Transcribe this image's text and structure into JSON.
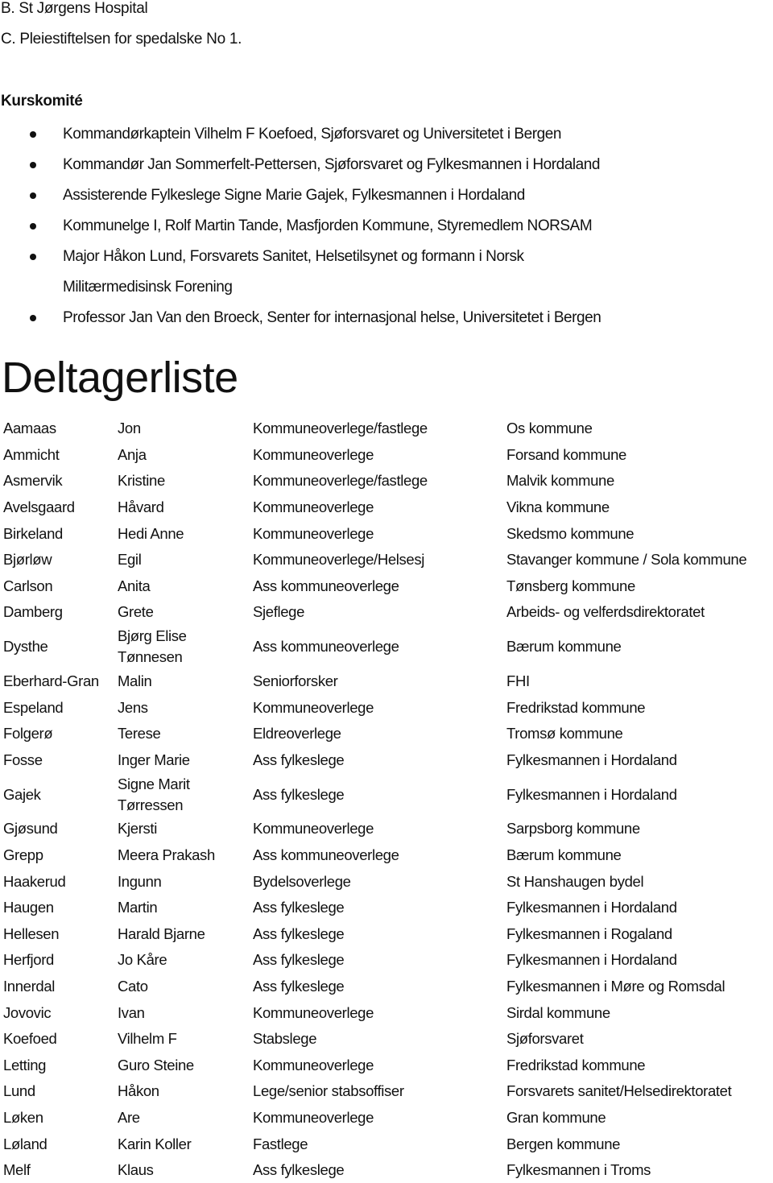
{
  "header_lines": [
    "B. St Jørgens Hospital",
    "C. Pleiestiftelsen for spedalske No 1."
  ],
  "committee": {
    "title": "Kurskomité",
    "items": [
      "Kommandørkaptein Vilhelm F Koefoed, Sjøforsvaret og Universitetet i Bergen",
      "Kommandør Jan Sommerfelt-Pettersen, Sjøforsvaret og Fylkesmannen i Hordaland",
      "Assisterende Fylkeslege Signe Marie Gajek, Fylkesmannen i Hordaland",
      "Kommunelge I, Rolf Martin Tande, Masfjorden Kommune, Styremedlem NORSAM",
      "Major Håkon Lund, Forsvarets Sanitet, Helsetilsynet og formann i Norsk",
      "Professor Jan Van den Broeck, Senter for internasjonal helse, Universitetet i Bergen"
    ],
    "item_continuation": "Militærmedisinsk Forening"
  },
  "participants": {
    "title": "Deltagerliste",
    "rows": [
      [
        "Aamaas",
        "Jon",
        "Kommuneoverlege/fastlege",
        "Os kommune"
      ],
      [
        "Ammicht",
        "Anja",
        "Kommuneoverlege",
        "Forsand kommune"
      ],
      [
        "Asmervik",
        "Kristine",
        "Kommuneoverlege/fastlege",
        "Malvik kommune"
      ],
      [
        "Avelsgaard",
        "Håvard",
        "Kommuneoverlege",
        "Vikna kommune"
      ],
      [
        "Birkeland",
        "Hedi Anne",
        "Kommuneoverlege",
        "Skedsmo kommune"
      ],
      [
        "Bjørløw",
        "Egil",
        "Kommuneoverlege/Helsesj",
        "Stavanger kommune / Sola kommune"
      ],
      [
        "Carlson",
        "Anita",
        "Ass kommuneoverlege",
        "Tønsberg kommune"
      ],
      [
        "Damberg",
        "Grete",
        "Sjeflege",
        "Arbeids- og velferdsdirektoratet"
      ],
      [
        "Dysthe",
        "Bjørg Elise Tønnesen",
        "Ass kommuneoverlege",
        "Bærum kommune"
      ],
      [
        "Eberhard-Gran",
        "Malin",
        "Seniorforsker",
        "FHI"
      ],
      [
        "Espeland",
        "Jens",
        "Kommuneoverlege",
        "Fredrikstad kommune"
      ],
      [
        "Folgerø",
        "Terese",
        "Eldreoverlege",
        "Tromsø kommune"
      ],
      [
        "Fosse",
        "Inger Marie",
        "Ass fylkeslege",
        "Fylkesmannen i Hordaland"
      ],
      [
        "Gajek",
        "Signe Marit Tørressen",
        "Ass fylkeslege",
        "Fylkesmannen i Hordaland"
      ],
      [
        "Gjøsund",
        "Kjersti",
        "Kommuneoverlege",
        "Sarpsborg kommune"
      ],
      [
        "Grepp",
        "Meera Prakash",
        "Ass kommuneoverlege",
        "Bærum kommune"
      ],
      [
        "Haakerud",
        "Ingunn",
        "Bydelsoverlege",
        "St Hanshaugen bydel"
      ],
      [
        "Haugen",
        "Martin",
        "Ass fylkeslege",
        "Fylkesmannen i Hordaland"
      ],
      [
        "Hellesen",
        "Harald Bjarne",
        "Ass fylkeslege",
        "Fylkesmannen i Rogaland"
      ],
      [
        "Herfjord",
        "Jo Kåre",
        "Ass fylkeslege",
        "Fylkesmannen i Hordaland"
      ],
      [
        "Innerdal",
        "Cato",
        "Ass fylkeslege",
        "Fylkesmannen i Møre og Romsdal"
      ],
      [
        "Jovovic",
        "Ivan",
        "Kommuneoverlege",
        "Sirdal kommune"
      ],
      [
        "Koefoed",
        "Vilhelm F",
        "Stabslege",
        "Sjøforsvaret"
      ],
      [
        "Letting",
        "Guro Steine",
        "Kommuneoverlege",
        "Fredrikstad kommune"
      ],
      [
        "Lund",
        "Håkon",
        "Lege/senior stabsoffiser",
        "Forsvarets sanitet/Helsedirektoratet"
      ],
      [
        "Løken",
        "Are",
        "Kommuneoverlege",
        "Gran kommune"
      ],
      [
        "Løland",
        "Karin Koller",
        "Fastlege",
        "Bergen kommune"
      ],
      [
        "Melf",
        "Klaus",
        "Ass fylkeslege",
        "Fylkesmannen i Troms"
      ]
    ]
  }
}
